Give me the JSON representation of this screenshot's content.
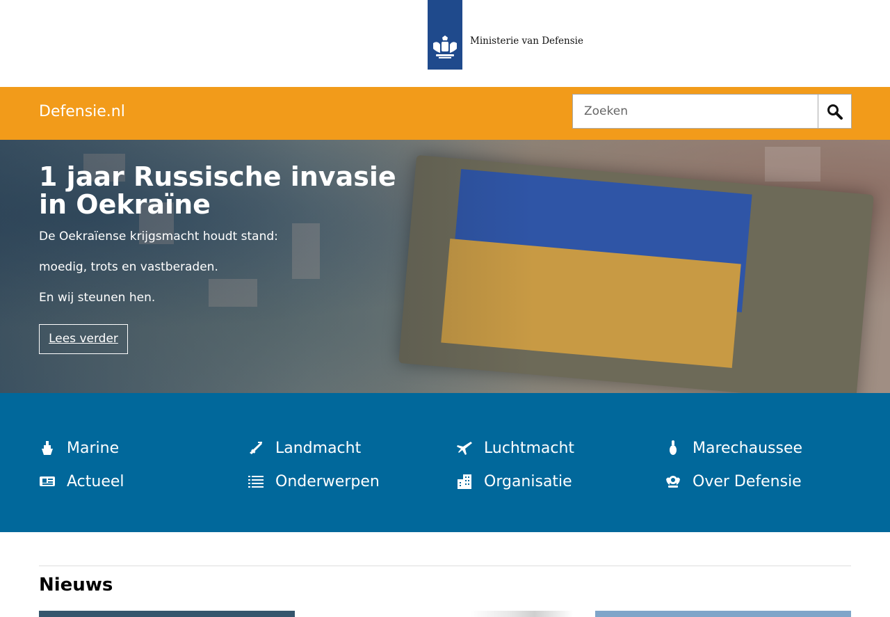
{
  "header": {
    "logo_text": "Ministerie van Defensie",
    "site_name": "Defensie.nl"
  },
  "search": {
    "placeholder": "Zoeken",
    "button_label": "Zoeken"
  },
  "hero": {
    "title": "1 jaar Russische invasie in Oekraïne",
    "paragraphs": [
      "De Oekraïense krijgsmacht houdt stand:",
      "moedig, trots en vastberaden.",
      "En wij steunen hen."
    ],
    "button_label": "Lees verder"
  },
  "nav": {
    "items": [
      {
        "label": "Marine",
        "icon": "ship-icon"
      },
      {
        "label": "Landmacht",
        "icon": "rifle-icon"
      },
      {
        "label": "Luchtmacht",
        "icon": "plane-icon"
      },
      {
        "label": "Marechaussee",
        "icon": "grenade-icon"
      },
      {
        "label": "Actueel",
        "icon": "newspaper-icon"
      },
      {
        "label": "Onderwerpen",
        "icon": "list-icon"
      },
      {
        "label": "Organisatie",
        "icon": "building-icon"
      },
      {
        "label": "Over Defensie",
        "icon": "emblem-icon"
      }
    ]
  },
  "news": {
    "title": "Nieuws"
  },
  "colors": {
    "brand_blue": "#01689b",
    "accent_orange": "#f29b1a",
    "logo_blue": "#1f4a8c"
  }
}
